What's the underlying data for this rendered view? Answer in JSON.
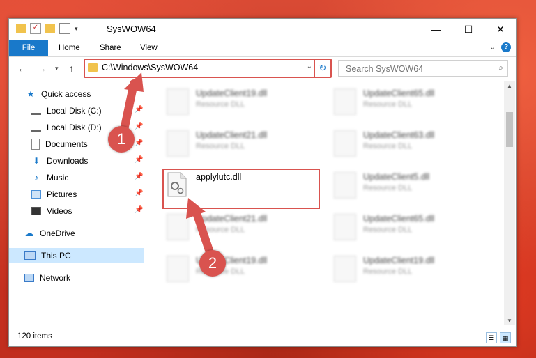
{
  "window": {
    "title": "SysWOW64"
  },
  "controls": {
    "minimize": "—",
    "maximize": "☐",
    "close": "✕"
  },
  "ribbon": {
    "tabs": [
      "File",
      "Home",
      "Share",
      "View"
    ],
    "help": "?"
  },
  "address": {
    "path": "C:\\Windows\\SysWOW64"
  },
  "search": {
    "placeholder": "Search SysWOW64"
  },
  "sidebar": {
    "quick_access": "Quick access",
    "items": [
      "Local Disk (C:)",
      "Local Disk (D:)",
      "Documents",
      "Downloads",
      "Music",
      "Pictures",
      "Videos"
    ],
    "onedrive": "OneDrive",
    "thispc": "This PC",
    "network": "Network"
  },
  "files": {
    "highlighted": {
      "name": "applylutc.dll"
    },
    "background": [
      {
        "name": "UpdateClient19.dll",
        "type": "Resource DLL"
      },
      {
        "name": "UpdateClient65.dll",
        "type": "Resource DLL"
      },
      {
        "name": "UpdateClient21.dll",
        "type": "Resource DLL"
      },
      {
        "name": "UpdateClient63.dll",
        "type": "Resource DLL"
      },
      {
        "name": "UpdateClient5.dll",
        "type": "Resource DLL"
      },
      {
        "name": "UpdateClient21.dll",
        "type": "Resource DLL"
      },
      {
        "name": "UpdateClient65.dll",
        "type": "Resource DLL"
      },
      {
        "name": "UpdateClient19.dll",
        "type": "Resource DLL"
      },
      {
        "name": "UpdateClient19.dll",
        "type": "Resource DLL"
      }
    ]
  },
  "status": {
    "count": "120 items"
  },
  "callouts": [
    "1",
    "2"
  ],
  "colors": {
    "accent": "#1979ca",
    "annotation": "#d9534f",
    "selected": "#cce8ff"
  }
}
